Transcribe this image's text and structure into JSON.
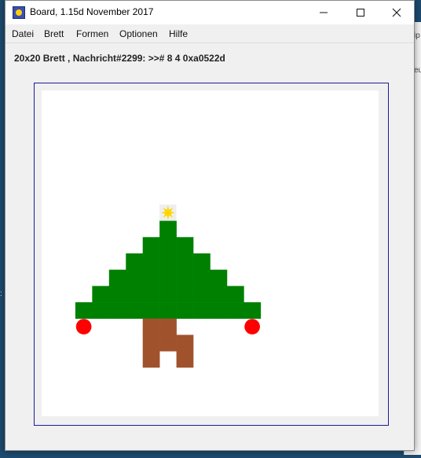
{
  "window": {
    "title": "Board, 1.15d November 2017",
    "icon": "app-board-icon"
  },
  "menu": {
    "items": [
      "Datei",
      "Brett",
      "Formen",
      "Optionen",
      "Hilfe"
    ]
  },
  "status": {
    "text": "20x20 Brett , Nachricht#2299: >># 8 4 0xa0522d"
  },
  "background_window": {
    "fragments": [
      "ip",
      "eu"
    ]
  },
  "board": {
    "rows": 20,
    "cols": 20,
    "colors": {
      "background": "#ffffff",
      "tree": "#008000",
      "trunk": "#a0522d",
      "ornament": "#ff0000",
      "star": "#ffd700",
      "star_cell": "#eeeeee",
      "frame": "#1b1b9a"
    },
    "shapes": [
      {
        "kind": "star",
        "cells": [
          [
            7,
            7
          ]
        ]
      },
      {
        "kind": "tree",
        "cells": [
          [
            8,
            7
          ],
          [
            9,
            6
          ],
          [
            9,
            7
          ],
          [
            9,
            8
          ],
          [
            10,
            5
          ],
          [
            10,
            6
          ],
          [
            10,
            7
          ],
          [
            10,
            8
          ],
          [
            10,
            9
          ],
          [
            11,
            4
          ],
          [
            11,
            5
          ],
          [
            11,
            6
          ],
          [
            11,
            7
          ],
          [
            11,
            8
          ],
          [
            11,
            9
          ],
          [
            11,
            10
          ],
          [
            12,
            3
          ],
          [
            12,
            4
          ],
          [
            12,
            5
          ],
          [
            12,
            6
          ],
          [
            12,
            7
          ],
          [
            12,
            8
          ],
          [
            12,
            9
          ],
          [
            12,
            10
          ],
          [
            12,
            11
          ],
          [
            13,
            2
          ],
          [
            13,
            3
          ],
          [
            13,
            4
          ],
          [
            13,
            5
          ],
          [
            13,
            6
          ],
          [
            13,
            7
          ],
          [
            13,
            8
          ],
          [
            13,
            9
          ],
          [
            13,
            10
          ],
          [
            13,
            11
          ],
          [
            13,
            12
          ]
        ]
      },
      {
        "kind": "trunk",
        "cells": [
          [
            14,
            6
          ],
          [
            14,
            7
          ],
          [
            15,
            6
          ],
          [
            15,
            7
          ],
          [
            15,
            8
          ],
          [
            16,
            6
          ],
          [
            16,
            8
          ]
        ]
      },
      {
        "kind": "ornament",
        "cells": [
          [
            14,
            2
          ],
          [
            14,
            12
          ]
        ]
      }
    ]
  }
}
